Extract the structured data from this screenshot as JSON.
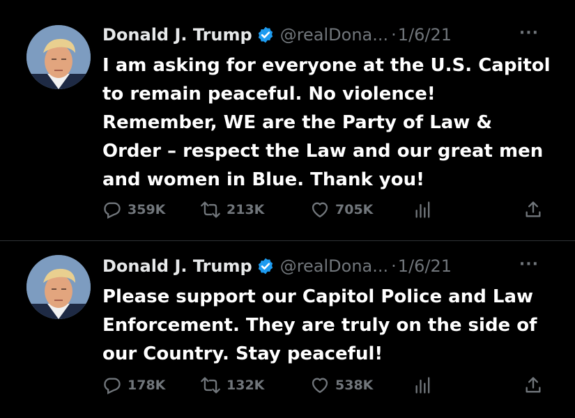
{
  "tweets": [
    {
      "author": "Donald J. Trump",
      "handle": "@realDona...",
      "separator": "·",
      "date": "1/6/21",
      "more": "···",
      "text": "I am asking for everyone at the U.S. Capitol\nto remain peaceful. No violence!\nRemember, WE are the Party of Law &\nOrder – respect the Law and our great men\nand women in Blue. Thank you!",
      "replies": "359K",
      "retweets": "213K",
      "likes": "705K",
      "icons": [
        "reply-icon",
        "retweet-icon",
        "like-icon",
        "views-icon",
        "share-icon"
      ]
    },
    {
      "author": "Donald J. Trump",
      "handle": "@realDona...",
      "separator": "·",
      "date": "1/6/21",
      "more": "···",
      "text": "Please support our Capitol Police and Law\nEnforcement. They are truly on the side of\nour Country. Stay peaceful!",
      "replies": "178K",
      "retweets": "132K",
      "likes": "538K",
      "icons": [
        "reply-icon",
        "retweet-icon",
        "like-icon",
        "views-icon",
        "share-icon"
      ]
    }
  ],
  "colors": {
    "background": "#000000",
    "text": "#ffffff",
    "muted": "#71767b",
    "verified": "#1d9bf0",
    "divider": "#2f3336"
  }
}
